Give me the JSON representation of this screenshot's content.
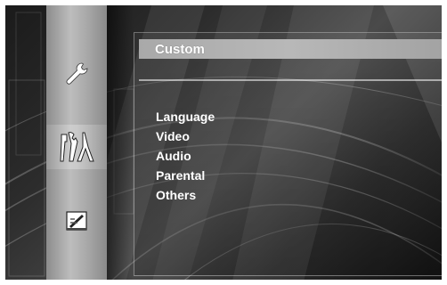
{
  "side_menu": {
    "icons": [
      {
        "name": "wrench-icon",
        "label": ""
      },
      {
        "name": "tools-icon",
        "label": ""
      },
      {
        "name": "document-icon",
        "label": ""
      }
    ],
    "selected_index": 1
  },
  "panel": {
    "title": "Custom",
    "items": [
      {
        "label": "Language"
      },
      {
        "label": "Video"
      },
      {
        "label": "Audio"
      },
      {
        "label": "Parental"
      },
      {
        "label": "Others"
      }
    ]
  },
  "colors": {
    "background_dark": "#1a1a1a",
    "title_bar": "#b0b0b0",
    "text": "#ffffff",
    "frame": "#ffffff"
  }
}
